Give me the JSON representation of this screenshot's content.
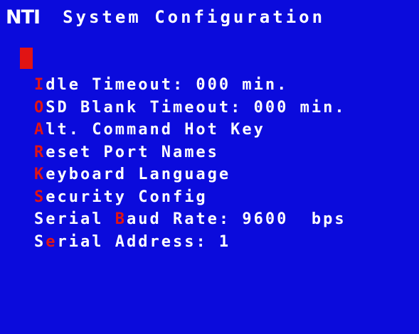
{
  "header": {
    "logo": "NTI",
    "title": "System Configuration"
  },
  "colors": {
    "background": "#0b0bdc",
    "text": "#ffffff",
    "hotkey": "#e11414"
  },
  "menu": {
    "items": [
      {
        "hot": "I",
        "rest": "dle Timeout: 000 min."
      },
      {
        "hot": "O",
        "rest": "SD Blank Timeout: 000 min."
      },
      {
        "hot": "A",
        "rest": "lt. Command Hot Key"
      },
      {
        "hot": "R",
        "rest": "eset Port Names"
      },
      {
        "hot": "K",
        "rest": "eyboard Language"
      },
      {
        "hot": "S",
        "rest": "ecurity Config"
      },
      {
        "pre": "Serial ",
        "hot": "B",
        "rest": "aud Rate: 9600  bps"
      },
      {
        "pre": "S",
        "hot": "e",
        "rest": "rial Address: 1"
      }
    ]
  }
}
